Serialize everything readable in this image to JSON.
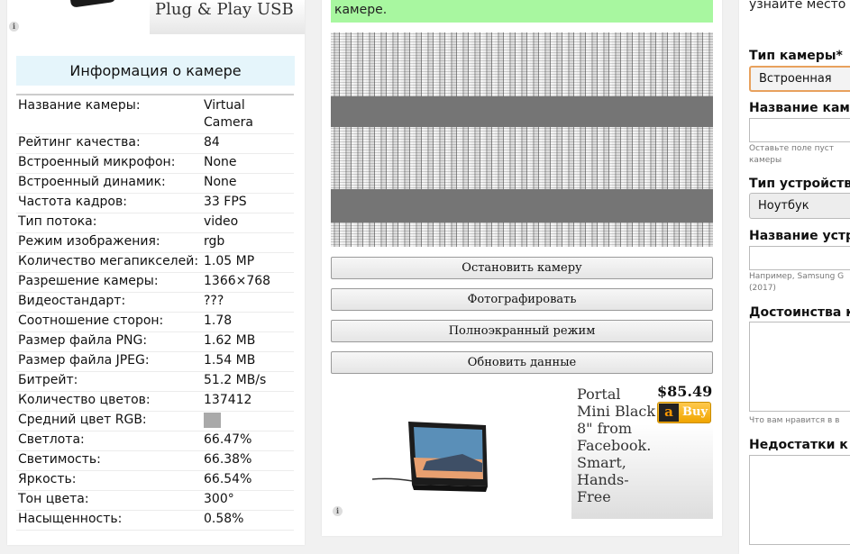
{
  "left_ad": {
    "title": "Plug & Play USB"
  },
  "camera_info": {
    "title": "Информация о камере",
    "rows": [
      {
        "key": "Название камеры:",
        "value": "Virtual Camera"
      },
      {
        "key": "Рейтинг качества:",
        "value": "84"
      },
      {
        "key": "Встроенный микрофон:",
        "value": "None"
      },
      {
        "key": "Встроенный динамик:",
        "value": "None"
      },
      {
        "key": "Частота кадров:",
        "value": "33 FPS"
      },
      {
        "key": "Тип потока:",
        "value": "video"
      },
      {
        "key": "Режим изображения:",
        "value": "rgb"
      },
      {
        "key": "Количество мегапикселей:",
        "value": "1.05 MP"
      },
      {
        "key": "Разрешение камеры:",
        "value": "1366×768"
      },
      {
        "key": "Видеостандарт:",
        "value": "???"
      },
      {
        "key": "Соотношение сторон:",
        "value": "1.78"
      },
      {
        "key": "Размер файла PNG:",
        "value": "1.62 MB"
      },
      {
        "key": "Размер файла JPEG:",
        "value": "1.54 MB"
      },
      {
        "key": "Битрейт:",
        "value": "51.2 MB/s"
      },
      {
        "key": "Количество цветов:",
        "value": "137412"
      },
      {
        "key": "Средний цвет RGB:",
        "value": "",
        "swatch_color": "#a9a9a9"
      },
      {
        "key": "Светлота:",
        "value": "66.47%"
      },
      {
        "key": "Светимость:",
        "value": "66.38%"
      },
      {
        "key": "Яркость:",
        "value": "66.54%"
      },
      {
        "key": "Тон цвета:",
        "value": "300°"
      },
      {
        "key": "Насыщенность:",
        "value": "0.58%"
      }
    ]
  },
  "camera_panel": {
    "note": "камере.",
    "buttons": {
      "stop": "Остановить камеру",
      "photo": "Фотографировать",
      "fullscreen": "Полноэкранный режим",
      "refresh": "Обновить данные"
    }
  },
  "bottom_ad": {
    "description": "Portal Mini Black 8\" from Facebook. Smart, Hands-Free",
    "price": "$85.49",
    "buy_label": "Buy",
    "amazon_letter": "a"
  },
  "form": {
    "intro": "узнайте место",
    "camera_type_label": "Тип камеры*",
    "camera_type_value": "Встроенная",
    "camera_name_label": "Название кам",
    "camera_name_hint_1": "Оставьте поле пуст",
    "camera_name_hint_2": "камеры",
    "device_type_label": "Тип устройств",
    "device_type_value": "Ноутбук",
    "device_name_label": "Название устр",
    "device_name_hint_1": "Например, Samsung G",
    "device_name_hint_2": "(2017)",
    "pros_label": "Достоинства к",
    "pros_hint": "Что вам нравится в в",
    "cons_label": "Недостатки к"
  },
  "colors": {
    "accent_green": "#a8f7a0",
    "title_bg": "#e5f5fb",
    "select_focus": "#e8a15d",
    "buy_button": "#f0a500"
  }
}
